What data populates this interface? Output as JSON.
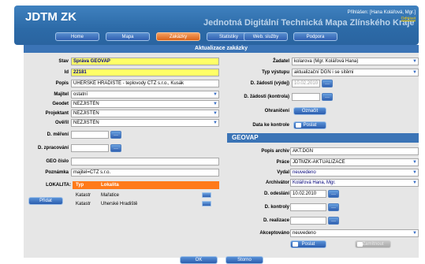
{
  "app": {
    "title": "JDTM ZK",
    "subtitle": "Jednotná Digitální Technická Mapa Zlínského Kraje",
    "user": "Přihlášen: [Hana Kolářová, Mgr.]",
    "logout": "Odhlásit"
  },
  "nav": [
    {
      "label": "Home"
    },
    {
      "label": "Mapa"
    },
    {
      "label": "Zakázky"
    },
    {
      "label": "Statistiky"
    },
    {
      "label": "Web. služby"
    },
    {
      "label": "Podpora"
    }
  ],
  "title_bar": "Aktualizace zakázky",
  "left": {
    "stav": {
      "label": "Stav",
      "value": "Správa GEOVAP"
    },
    "id": {
      "label": "Id",
      "value": "22181"
    },
    "popis": {
      "label": "Popis",
      "value": "UHERSKÉ HRADIŠTĚ - teplovody CTZ s.r.o., Kusák"
    },
    "majitel": {
      "label": "Majitel",
      "value": "ostatní"
    },
    "geodet": {
      "label": "Geodet",
      "value": "NEZJIŠTĚN"
    },
    "projektant": {
      "label": "Projektant",
      "value": "NEZJIŠTĚN"
    },
    "overil": {
      "label": "Ověřil",
      "value": "NEZJIŠTĚN"
    },
    "d_mereni": {
      "label": "D. měření",
      "value": ""
    },
    "d_zpracovani": {
      "label": "D. zpracování",
      "value": ""
    },
    "geo_cislo": {
      "label": "GEO číslo",
      "value": ""
    },
    "poznamka": {
      "label": "Poznámka",
      "value": "majitel=CTZ s.r.o."
    },
    "lokality": {
      "label": "LOKALITA:",
      "headers": [
        "Typ",
        "Lokalita"
      ],
      "rows": [
        {
          "typ": "Katastr",
          "lokalita": "Mařatice"
        },
        {
          "typ": "Katastr",
          "lokalita": "Uherské Hradiště"
        }
      ],
      "add_button": "Přidat"
    }
  },
  "right": {
    "zadatel": {
      "label": "Žadatel",
      "value": "kolarova (Mgr. Kolářová Hana)"
    },
    "typ_vystupu": {
      "label": "Typ výstupu",
      "value": "aktualizační DGN i se sítěmi"
    },
    "d_zadosti_vydej": {
      "label": "D. žádosti (výdej)",
      "value": "10.02.2010"
    },
    "d_zadosti_kontrola": {
      "label": "D. žádosti (kontrola)",
      "value": ""
    },
    "ohraniceni": {
      "label": "Ohraničení",
      "button": "Označit"
    },
    "data_ke_kontrole": {
      "label": "Data ke kontrole",
      "button": "Poslat"
    }
  },
  "geovap": {
    "title": "GEOVAP",
    "popis_archiv": {
      "label": "Popis archiv",
      "value": "AKT.DGN"
    },
    "prace": {
      "label": "Práce",
      "value": "JDTMZK-AKTUALIZACE"
    },
    "vydal": {
      "label": "Vydal",
      "value": "neuvedeno"
    },
    "archivator": {
      "label": "Archivátor",
      "value": "Kolářová Hana, Mgr."
    },
    "d_odeslani": {
      "label": "D. odeslání",
      "value": "10.02.2010"
    },
    "d_kontroly": {
      "label": "D. kontroly",
      "value": ""
    },
    "d_realizace": {
      "label": "D. realizace",
      "value": ""
    },
    "akceptovano": {
      "label": "Akceptováno",
      "value": "neuvedeno"
    },
    "send_button": "Poslat",
    "reject_button": "Zamítnout"
  },
  "footer": {
    "ok": "OK",
    "storno": "Storno"
  }
}
